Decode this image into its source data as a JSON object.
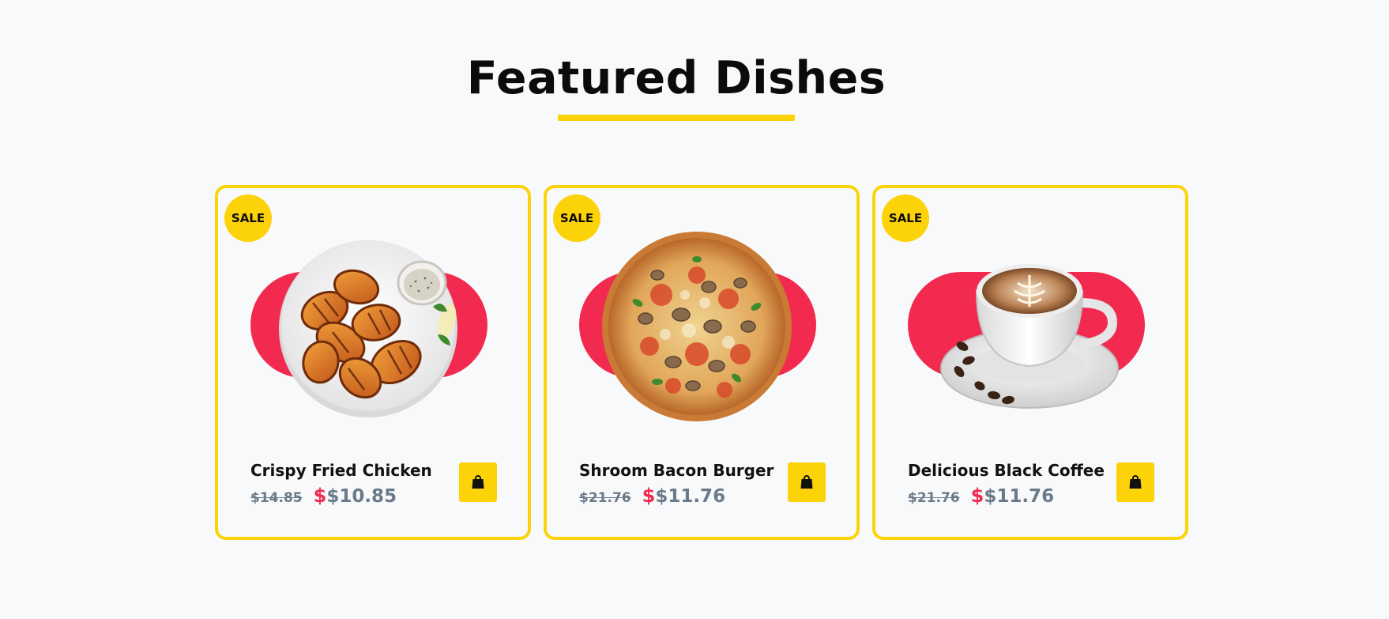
{
  "section": {
    "title": "Featured Dishes"
  },
  "colors": {
    "accent_yellow": "#fcd208",
    "accent_red": "#f22a4f",
    "muted_price": "#6b7a89"
  },
  "dishes": [
    {
      "badge": "SALE",
      "name": "Crispy Fried Chicken",
      "old_price": "$14.85",
      "currency": "$",
      "new_price": "$10.85",
      "image": "fried-chicken-plate",
      "cart_icon": "shopping-bag-icon"
    },
    {
      "badge": "SALE",
      "name": "Shroom Bacon Burger",
      "old_price": "$21.76",
      "currency": "$",
      "new_price": "$11.76",
      "image": "mushroom-pizza",
      "cart_icon": "shopping-bag-icon"
    },
    {
      "badge": "SALE",
      "name": "Delicious Black Coffee",
      "old_price": "$21.76",
      "currency": "$",
      "new_price": "$11.76",
      "image": "latte-coffee-cup",
      "cart_icon": "shopping-bag-icon"
    }
  ]
}
